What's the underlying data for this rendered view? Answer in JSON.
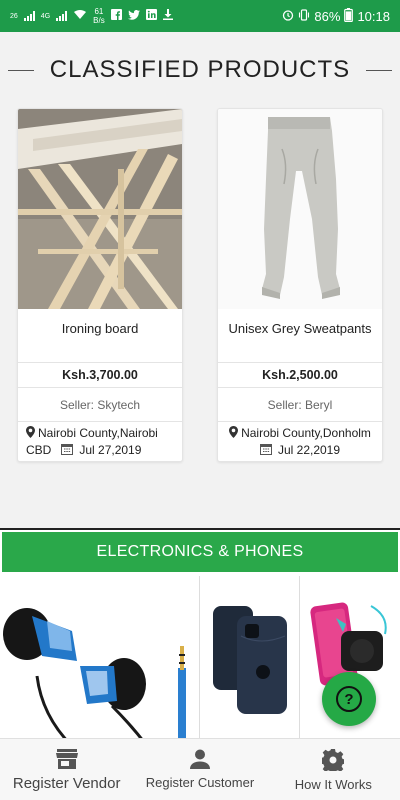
{
  "status_bar": {
    "network_left": "26",
    "network_right": "4G",
    "speed_value": "61",
    "speed_unit": "B/s",
    "battery": "86%",
    "time": "10:18"
  },
  "section": {
    "title": "CLASSIFIED PRODUCTS"
  },
  "products": [
    {
      "name": "Ironing board",
      "price": "Ksh.3,700.00",
      "seller": "Seller: Skytech",
      "location": "Nairobi County,Nairobi CBD",
      "date": "Jul 27,2019"
    },
    {
      "name": "Unisex Grey Sweatpants",
      "price": "Ksh.2,500.00",
      "seller": "Seller: Beryl",
      "location": "Nairobi County,Donholm",
      "date": "Jul 22,2019"
    }
  ],
  "category": {
    "title": "ELECTRONICS & PHONES"
  },
  "fab": {
    "label": "?"
  },
  "bottom_nav": [
    {
      "label": "Register Vendor",
      "icon": "store-icon"
    },
    {
      "label": "Register Customer",
      "icon": "person-icon"
    },
    {
      "label": "How It Works",
      "icon": "gear-icon"
    }
  ],
  "colors": {
    "primary": "#1e9b4a",
    "banner": "#2aa84a"
  }
}
